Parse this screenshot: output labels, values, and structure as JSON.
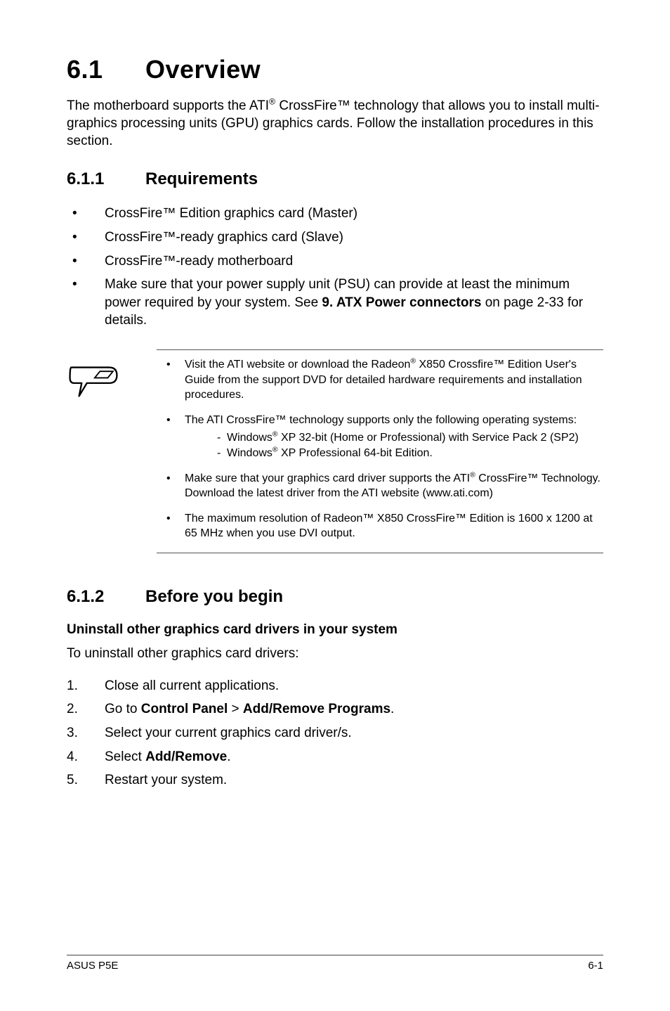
{
  "section": {
    "num": "6.1",
    "title": "Overview"
  },
  "intro_parts": {
    "a": "The motherboard supports the ATI",
    "reg1": "®",
    "b": " CrossFire™ technology that allows you to install multi-graphics processing units (GPU) graphics cards. Follow the installation procedures in this section."
  },
  "sub1": {
    "num": "6.1.1",
    "title": "Requirements"
  },
  "req": [
    "CrossFire™ Edition graphics card (Master)",
    "CrossFire™-ready graphics card (Slave)",
    "CrossFire™-ready motherboard"
  ],
  "req_power": {
    "a": "Make sure that your power supply unit (PSU) can provide at least the minimum power required by your system. See ",
    "bold": "9. ATX Power connectors",
    "b": " on page 2-33 for details."
  },
  "notes": {
    "n1": {
      "a": "Visit the ATI website or download the Radeon",
      "reg": "®",
      "b": " X850 Crossfire™ Edition User's Guide from the support DVD for detailed hardware requirements and installation procedures."
    },
    "n2": {
      "a": "The ATI CrossFire™ technology supports only the following operating systems:",
      "sub1": {
        "a": "Windows",
        "reg": "®",
        "b": " XP 32-bit  (Home or Professional) with Service Pack 2 (SP2)"
      },
      "sub2": {
        "a": "Windows",
        "reg": "®",
        "b": " XP Professional 64-bit Edition."
      }
    },
    "n3": {
      "a": "Make sure that your graphics card driver supports the ATI",
      "reg": "®",
      "b": " CrossFire™ Technology. Download the latest driver from the ATI website (www.ati.com)"
    },
    "n4": "The maximum resolution of Radeon™ X850 CrossFire™ Edition is 1600 x 1200 at 65 MHz when you use DVI output."
  },
  "sub2": {
    "num": "6.1.2",
    "title": "Before you begin"
  },
  "uninstall_heading": "Uninstall other graphics card drivers in your system",
  "uninstall_intro": "To uninstall other graphics card drivers:",
  "steps": {
    "s1": "Close all current applications.",
    "s2": {
      "a": "Go to ",
      "b": "Control Panel",
      "c": " > ",
      "d": "Add/Remove Programs",
      "e": "."
    },
    "s3": "Select your current graphics card driver/s.",
    "s4": {
      "a": "Select ",
      "b": "Add/Remove",
      "c": "."
    },
    "s5": "Restart your system."
  },
  "footer": {
    "left": "ASUS P5E",
    "right": "6-1"
  }
}
